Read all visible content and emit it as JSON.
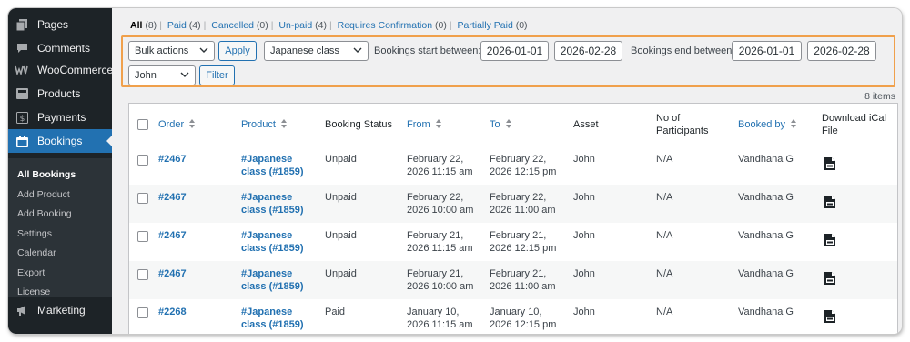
{
  "sidebar": {
    "items": [
      {
        "label": "Pages",
        "icon": "pages-icon"
      },
      {
        "label": "Comments",
        "icon": "comments-icon"
      },
      {
        "label": "WooCommerce",
        "icon": "woocommerce-icon"
      },
      {
        "label": "Products",
        "icon": "products-icon"
      },
      {
        "label": "Payments",
        "icon": "payments-icon"
      },
      {
        "label": "Bookings",
        "icon": "bookings-calendar-icon"
      },
      {
        "label": "Marketing",
        "icon": "marketing-megaphone-icon"
      }
    ],
    "submenu": [
      "All Bookings",
      "Add Product",
      "Add Booking",
      "Settings",
      "Calendar",
      "Export",
      "License"
    ],
    "active_color": "#2271b1"
  },
  "status_filters": [
    {
      "label": "All",
      "count": "(8)"
    },
    {
      "label": "Paid",
      "count": "(4)"
    },
    {
      "label": "Cancelled",
      "count": "(0)"
    },
    {
      "label": "Un-paid",
      "count": "(4)"
    },
    {
      "label": "Requires Confirmation",
      "count": "(0)"
    },
    {
      "label": "Partially Paid",
      "count": "(0)"
    }
  ],
  "filters": {
    "bulk_actions": "Bulk actions",
    "apply": "Apply",
    "product": "Japanese class",
    "start_label": "Bookings start between:",
    "start_from": "2026-01-01",
    "start_to": "2026-02-28",
    "end_label": "Bookings end between:",
    "end_from": "2026-01-01",
    "end_to": "2026-02-28",
    "user": "John",
    "filter": "Filter",
    "highlight_color": "#f0a04b"
  },
  "items_count": "8 items",
  "table": {
    "columns": {
      "order": "Order",
      "product": "Product",
      "status": "Booking Status",
      "from": "From",
      "to": "To",
      "asset": "Asset",
      "participants": [
        "No of",
        "Participants"
      ],
      "booked_by": "Booked by",
      "ical": [
        "Download iCal",
        "File"
      ]
    },
    "rows": [
      {
        "order": "#2467",
        "product": [
          "#Japanese",
          "class (#1859)"
        ],
        "status": "Unpaid",
        "from": [
          "February 22,",
          "2026 11:15 am"
        ],
        "to": [
          "February 22,",
          "2026 12:15 pm"
        ],
        "asset": "John",
        "participants": "N/A",
        "booked_by": "Vandhana G"
      },
      {
        "order": "#2467",
        "product": [
          "#Japanese",
          "class (#1859)"
        ],
        "status": "Unpaid",
        "from": [
          "February 22,",
          "2026 10:00 am"
        ],
        "to": [
          "February 22,",
          "2026 11:00 am"
        ],
        "asset": "John",
        "participants": "N/A",
        "booked_by": "Vandhana G"
      },
      {
        "order": "#2467",
        "product": [
          "#Japanese",
          "class (#1859)"
        ],
        "status": "Unpaid",
        "from": [
          "February 21,",
          "2026 11:15 am"
        ],
        "to": [
          "February 21,",
          "2026 12:15 pm"
        ],
        "asset": "John",
        "participants": "N/A",
        "booked_by": "Vandhana G"
      },
      {
        "order": "#2467",
        "product": [
          "#Japanese",
          "class (#1859)"
        ],
        "status": "Unpaid",
        "from": [
          "February 21,",
          "2026 10:00 am"
        ],
        "to": [
          "February 21,",
          "2026 11:00 am"
        ],
        "asset": "John",
        "participants": "N/A",
        "booked_by": "Vandhana G"
      },
      {
        "order": "#2268",
        "product": [
          "#Japanese",
          "class (#1859)"
        ],
        "status": "Paid",
        "from": [
          "January 10,",
          "2026 11:15 am"
        ],
        "to": [
          "January 10,",
          "2026 12:15 pm"
        ],
        "asset": "John",
        "participants": "N/A",
        "booked_by": "Vandhana G"
      }
    ]
  }
}
